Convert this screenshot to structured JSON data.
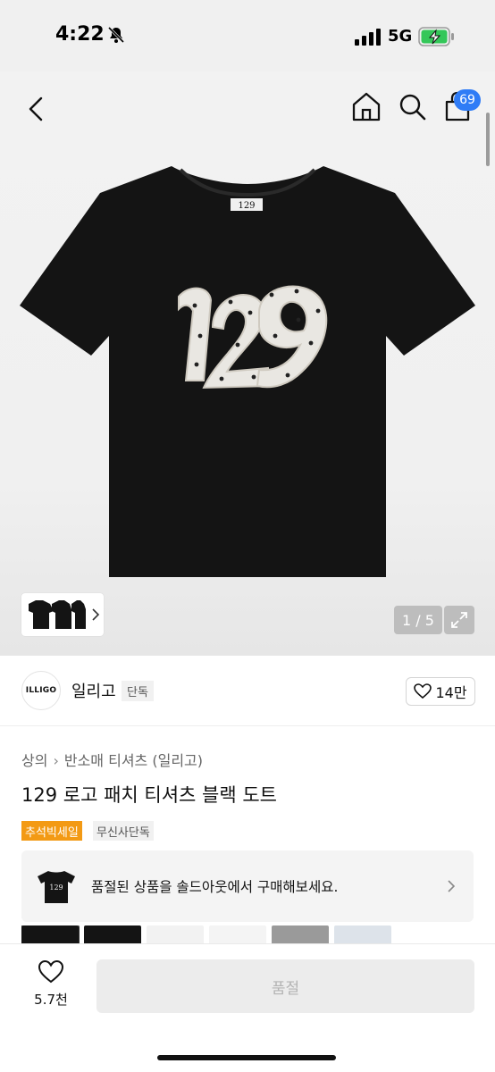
{
  "status_bar": {
    "time": "4:22",
    "network": "5G"
  },
  "header": {
    "cart_count": "69"
  },
  "gallery": {
    "counter": "1 / 5"
  },
  "brand": {
    "logo_text": "ILLIGO",
    "name": "일리고",
    "tag": "단독",
    "likes": "14만"
  },
  "breadcrumb": {
    "category": "상의",
    "subcategory": "반소매 티셔츠 (일리고)"
  },
  "product": {
    "title": "129 로고 패치 티셔츠 블랙 도트",
    "badges": [
      "추석빅세일",
      "무신사단독"
    ]
  },
  "soldout_banner": {
    "text": "품절된 상품을 솔드아웃에서 구매해보세요."
  },
  "bottom_bar": {
    "wish_count": "5.7천",
    "buy_label": "품절"
  },
  "colors": {
    "accent_blue": "#2f7cf6",
    "sale_orange": "#f39a14"
  }
}
